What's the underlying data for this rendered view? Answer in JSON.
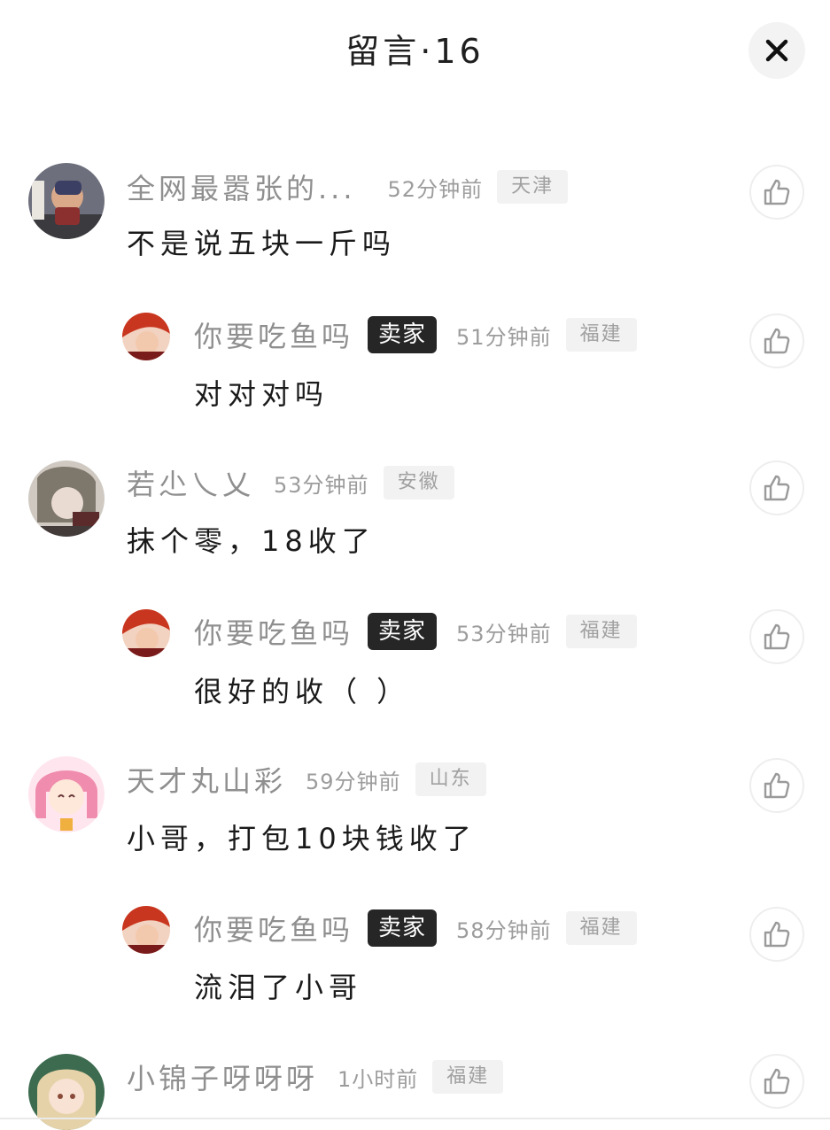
{
  "header": {
    "title": "留言·16"
  },
  "icons": {
    "close": "close-icon",
    "like": "thumbs-up-icon"
  },
  "colors": {
    "seller_badge_bg": "#262626",
    "location_bg": "#f2f2f2",
    "muted_text": "#8f8f8f"
  },
  "comments": [
    {
      "username": "全网最嚣张的...",
      "time": "52分钟前",
      "location": "天津",
      "text": "不是说五块一斤吗",
      "is_reply": false
    },
    {
      "username": "你要吃鱼吗",
      "badge": "卖家",
      "time": "51分钟前",
      "location": "福建",
      "text": "对对对吗",
      "is_reply": true
    },
    {
      "username": "若尐乀乂",
      "time": "53分钟前",
      "location": "安徽",
      "text": "抹个零，18收了",
      "is_reply": false
    },
    {
      "username": "你要吃鱼吗",
      "badge": "卖家",
      "time": "53分钟前",
      "location": "福建",
      "text": "很好的收（ ）",
      "is_reply": true
    },
    {
      "username": "天才丸山彩",
      "time": "59分钟前",
      "location": "山东",
      "text": "小哥，打包10块钱收了",
      "is_reply": false
    },
    {
      "username": "你要吃鱼吗",
      "badge": "卖家",
      "time": "58分钟前",
      "location": "福建",
      "text": "流泪了小哥",
      "is_reply": true
    },
    {
      "username": "小锦子呀呀呀",
      "time": "1小时前",
      "location": "福建",
      "text": "",
      "is_reply": false
    }
  ]
}
